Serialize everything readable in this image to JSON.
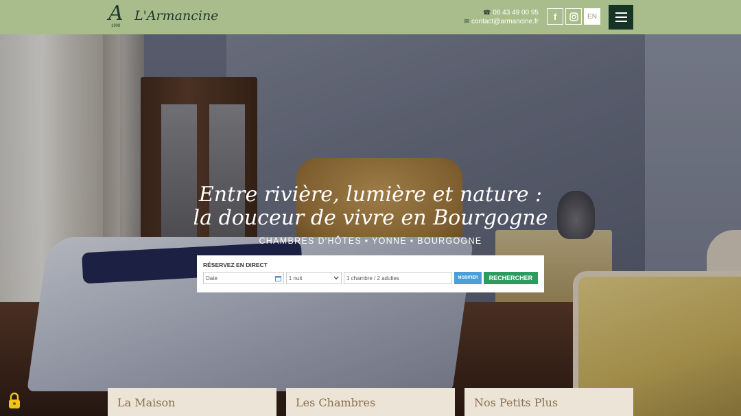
{
  "header": {
    "logo_text": "L'Armancine",
    "logo_letter": "A",
    "logo_year": "1908",
    "phone": "06 43 49 00 95",
    "email": "contact@armancine.fr",
    "lang": "EN"
  },
  "hero": {
    "headline_1": "Entre rivière, lumière et nature :",
    "headline_2": "la douceur de vivre en Bourgogne",
    "subline": "CHAMBRES D'HÔTES • YONNE • BOURGOGNE"
  },
  "booking": {
    "title": "RÉSERVEZ EN DIRECT",
    "date_placeholder": "Date",
    "nights": "1 nuit",
    "rooms": "1 chambre / 2 adultes",
    "modify_label": "MODIFIER",
    "search_label": "RECHERCHER"
  },
  "cards": [
    {
      "title": "La Maison"
    },
    {
      "title": "Les Chambres"
    },
    {
      "title": "Nos Petits Plus"
    }
  ],
  "colors": {
    "header_bg": "#a9bd8c",
    "menu_bg": "#163325",
    "search_btn": "#2a9c5f",
    "modify_btn": "#4a9fd8",
    "card_bg": "#ece4d7"
  }
}
